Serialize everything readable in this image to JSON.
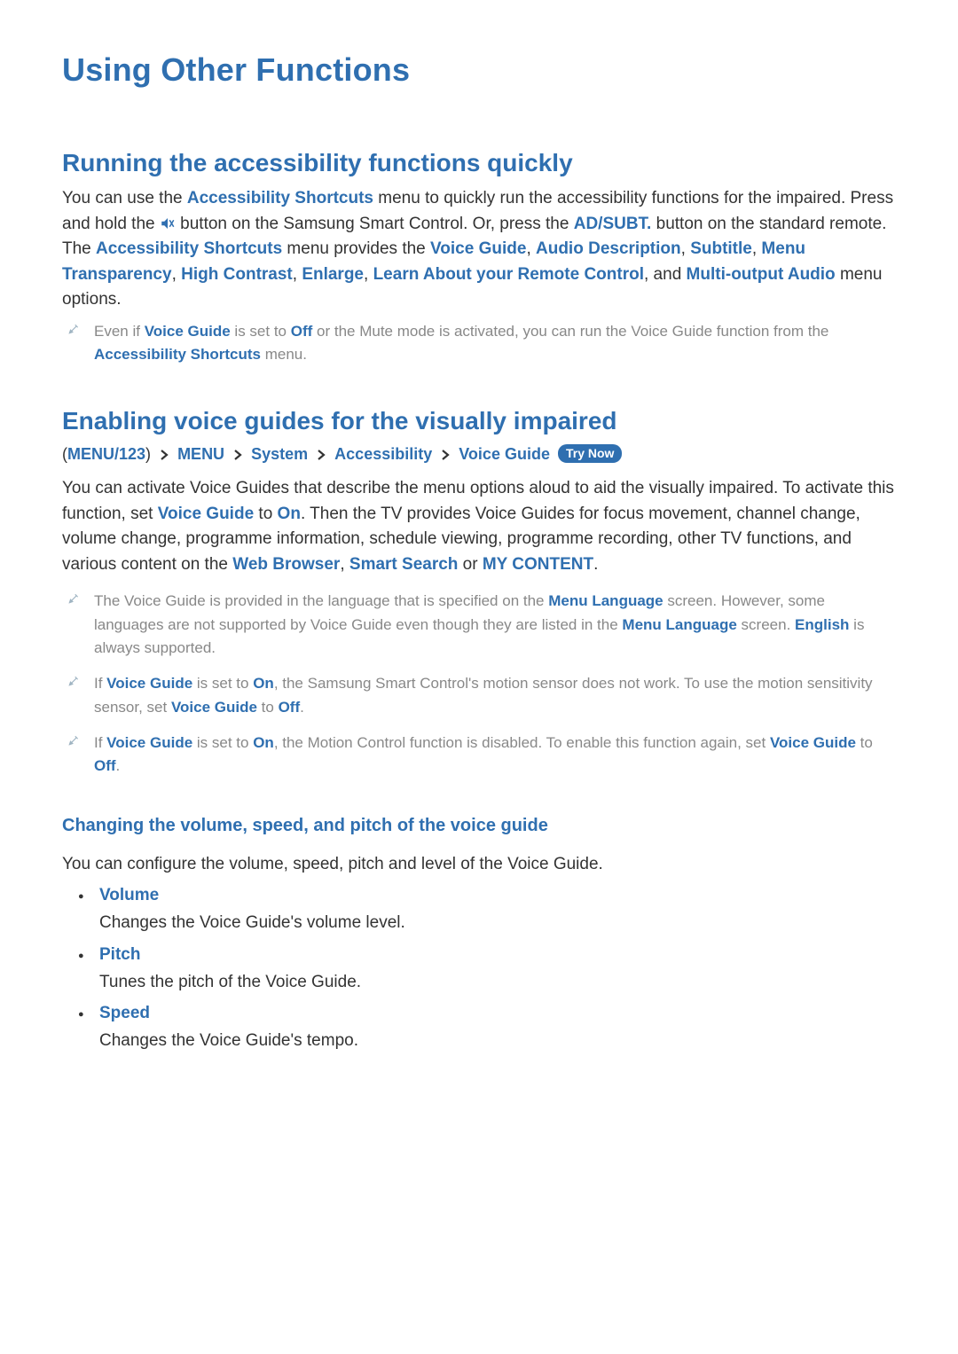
{
  "page": {
    "title": "Using Other Functions"
  },
  "section1": {
    "heading": "Running the accessibility functions quickly",
    "p_parts": [
      {
        "t": "You can use the "
      },
      {
        "t": "Accessibility Shortcuts",
        "blue": true
      },
      {
        "t": " menu to quickly run the accessibility functions for the impaired. Press and hold the "
      },
      {
        "icon": "mute-speaker-icon"
      },
      {
        "t": " button on the Samsung Smart Control. Or, press the "
      },
      {
        "t": "AD/SUBT.",
        "blue": true
      },
      {
        "t": " button on the standard remote. The "
      },
      {
        "t": "Accessibility Shortcuts",
        "blue": true
      },
      {
        "t": " menu provides the "
      },
      {
        "t": "Voice Guide",
        "blue": true
      },
      {
        "t": ", "
      },
      {
        "t": "Audio Description",
        "blue": true
      },
      {
        "t": ", "
      },
      {
        "t": "Subtitle",
        "blue": true
      },
      {
        "t": ", "
      },
      {
        "t": "Menu Transparency",
        "blue": true
      },
      {
        "t": ", "
      },
      {
        "t": "High Contrast",
        "blue": true
      },
      {
        "t": ", "
      },
      {
        "t": "Enlarge",
        "blue": true
      },
      {
        "t": ", "
      },
      {
        "t": "Learn About your Remote Control",
        "blue": true
      },
      {
        "t": ", and "
      },
      {
        "t": "Multi-output Audio",
        "blue": true
      },
      {
        "t": " menu options."
      }
    ],
    "note1_parts": [
      {
        "t": "Even if "
      },
      {
        "t": "Voice Guide",
        "blue": true
      },
      {
        "t": " is set to "
      },
      {
        "t": "Off",
        "blue": true
      },
      {
        "t": " or the Mute mode is activated, you can run the Voice Guide function from the "
      },
      {
        "t": "Accessibility Shortcuts",
        "blue": true
      },
      {
        "t": " menu."
      }
    ]
  },
  "section2": {
    "heading": "Enabling voice guides for the visually impaired",
    "breadcrumb": {
      "open": "(",
      "close": ")",
      "items": [
        "MENU/123",
        "MENU",
        "System",
        "Accessibility",
        "Voice Guide"
      ],
      "try_now": "Try Now"
    },
    "p_parts": [
      {
        "t": "You can activate Voice Guides that describe the menu options aloud to aid the visually impaired. To activate this function, set "
      },
      {
        "t": "Voice Guide",
        "blue": true
      },
      {
        "t": " to "
      },
      {
        "t": "On",
        "blue": true
      },
      {
        "t": ". Then the TV provides Voice Guides for focus movement, channel change, volume change, programme information, schedule viewing, programme recording, other TV functions, and various content on the "
      },
      {
        "t": "Web Browser",
        "blue": true
      },
      {
        "t": ", "
      },
      {
        "t": "Smart Search",
        "blue": true
      },
      {
        "t": " or "
      },
      {
        "t": "MY CONTENT",
        "blue": true
      },
      {
        "t": "."
      }
    ],
    "notes": [
      [
        {
          "t": "The Voice Guide is provided in the language that is specified on the "
        },
        {
          "t": "Menu Language",
          "blue": true
        },
        {
          "t": " screen. However, some languages are not supported by Voice Guide even though they are listed in the "
        },
        {
          "t": "Menu Language",
          "blue": true
        },
        {
          "t": " screen. "
        },
        {
          "t": "English",
          "blue": true
        },
        {
          "t": " is always supported."
        }
      ],
      [
        {
          "t": "If "
        },
        {
          "t": "Voice Guide",
          "blue": true
        },
        {
          "t": " is set to "
        },
        {
          "t": "On",
          "blue": true
        },
        {
          "t": ", the Samsung Smart Control's motion sensor does not work. To use the motion sensitivity sensor, set "
        },
        {
          "t": "Voice Guide",
          "blue": true
        },
        {
          "t": " to "
        },
        {
          "t": "Off",
          "blue": true
        },
        {
          "t": "."
        }
      ],
      [
        {
          "t": "If "
        },
        {
          "t": "Voice Guide",
          "blue": true
        },
        {
          "t": " is set to "
        },
        {
          "t": "On",
          "blue": true
        },
        {
          "t": ", the Motion Control function is disabled. To enable this function again, set "
        },
        {
          "t": "Voice Guide",
          "blue": true
        },
        {
          "t": " to "
        },
        {
          "t": "Off",
          "blue": true
        },
        {
          "t": "."
        }
      ]
    ]
  },
  "section3": {
    "heading": "Changing the volume, speed, and pitch of the voice guide",
    "intro": "You can configure the volume, speed, pitch and level of the Voice Guide.",
    "items": [
      {
        "label": "Volume",
        "desc": "Changes the Voice Guide's volume level."
      },
      {
        "label": "Pitch",
        "desc": "Tunes the pitch of the Voice Guide."
      },
      {
        "label": "Speed",
        "desc": "Changes the Voice Guide's tempo."
      }
    ]
  }
}
